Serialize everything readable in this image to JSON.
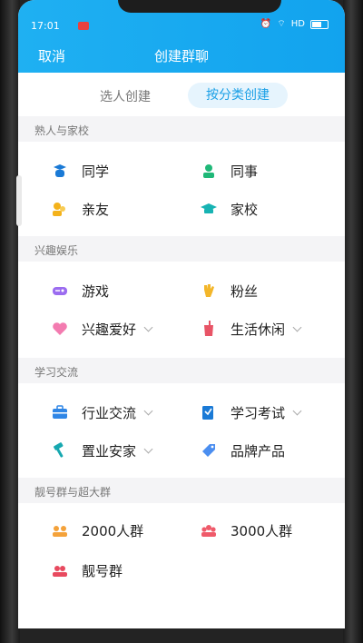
{
  "status_bar": {
    "time": "17:01",
    "signal": "HD"
  },
  "nav": {
    "cancel": "取消",
    "title": "创建群聊"
  },
  "tabs": [
    {
      "label": "选人创建",
      "active": false
    },
    {
      "label": "按分类创建",
      "active": true
    }
  ],
  "sections": [
    {
      "title": "熟人与家校",
      "items": [
        {
          "label": "同学",
          "icon": "student-icon",
          "color": "#1a7ad6"
        },
        {
          "label": "同事",
          "icon": "coworker-icon",
          "color": "#1fb878"
        },
        {
          "label": "亲友",
          "icon": "family-icon",
          "color": "#f4b21b"
        },
        {
          "label": "家校",
          "icon": "school-icon",
          "color": "#17b3b3"
        }
      ]
    },
    {
      "title": "兴趣娱乐",
      "items": [
        {
          "label": "游戏",
          "icon": "gamepad-icon",
          "color": "#9b6cf0"
        },
        {
          "label": "粉丝",
          "icon": "fan-hand-icon",
          "color": "#f3b62a"
        },
        {
          "label": "兴趣爱好",
          "icon": "heart-icon",
          "color": "#f37bb0",
          "dropdown": true
        },
        {
          "label": "生活休闲",
          "icon": "drink-icon",
          "color": "#e85466",
          "dropdown": true
        }
      ]
    },
    {
      "title": "学习交流",
      "items": [
        {
          "label": "行业交流",
          "icon": "briefcase-icon",
          "color": "#2f86e6",
          "dropdown": true
        },
        {
          "label": "学习考试",
          "icon": "exam-icon",
          "color": "#1a7ad6",
          "dropdown": true
        },
        {
          "label": "置业安家",
          "icon": "hammer-icon",
          "color": "#16a8b0",
          "dropdown": true
        },
        {
          "label": "品牌产品",
          "icon": "tag-icon",
          "color": "#4b8ef0"
        }
      ]
    },
    {
      "title": "靓号群与超大群",
      "items": [
        {
          "label": "2000人群",
          "icon": "group-2000-icon",
          "color": "#f4a23a"
        },
        {
          "label": "3000人群",
          "icon": "group-3000-icon",
          "color": "#ef5a6a"
        },
        {
          "label": "靓号群",
          "icon": "vip-group-icon",
          "color": "#e84a5f"
        }
      ]
    }
  ]
}
